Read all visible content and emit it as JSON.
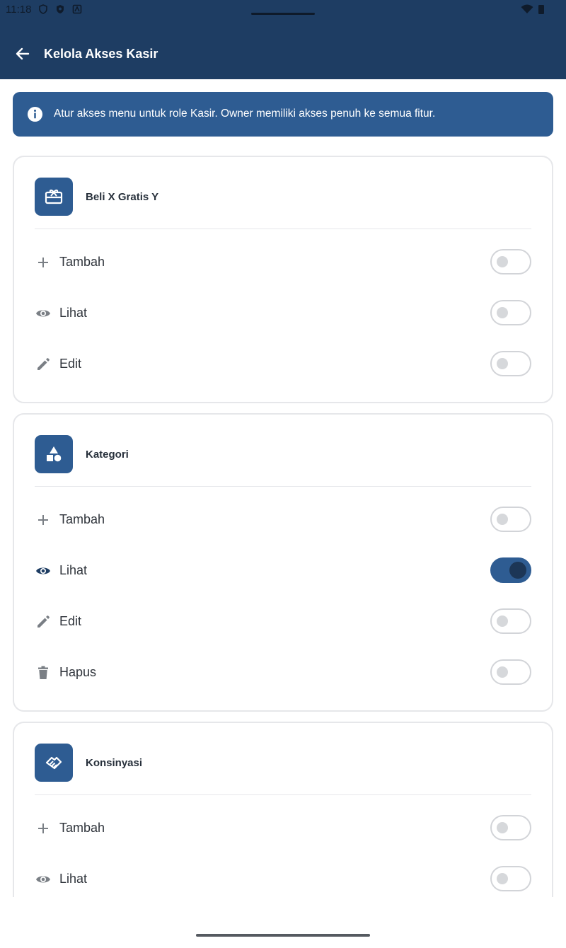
{
  "status": {
    "time": "11:18"
  },
  "header": {
    "title": "Kelola Akses Kasir"
  },
  "banner": {
    "text": "Atur akses menu untuk role Kasir. Owner memiliki akses penuh ke semua fitur."
  },
  "cards": [
    {
      "title": "Beli X Gratis Y",
      "icon": "gift-card-icon",
      "rows": [
        {
          "label": "Tambah",
          "icon": "plus-icon",
          "enabled": false
        },
        {
          "label": "Lihat",
          "icon": "eye-icon",
          "enabled": false
        },
        {
          "label": "Edit",
          "icon": "pencil-icon",
          "enabled": false
        }
      ]
    },
    {
      "title": "Kategori",
      "icon": "shapes-icon",
      "rows": [
        {
          "label": "Tambah",
          "icon": "plus-icon",
          "enabled": false
        },
        {
          "label": "Lihat",
          "icon": "eye-icon",
          "enabled": true
        },
        {
          "label": "Edit",
          "icon": "pencil-icon",
          "enabled": false
        },
        {
          "label": "Hapus",
          "icon": "trash-icon",
          "enabled": false
        }
      ]
    },
    {
      "title": "Konsinyasi",
      "icon": "handshake-icon",
      "rows": [
        {
          "label": "Tambah",
          "icon": "plus-icon",
          "enabled": false
        },
        {
          "label": "Lihat",
          "icon": "eye-icon",
          "enabled": false
        }
      ]
    }
  ],
  "colors": {
    "primary": "#1e3d63",
    "accent": "#2e5c92",
    "toggle_knob_on": "#1c3656"
  }
}
